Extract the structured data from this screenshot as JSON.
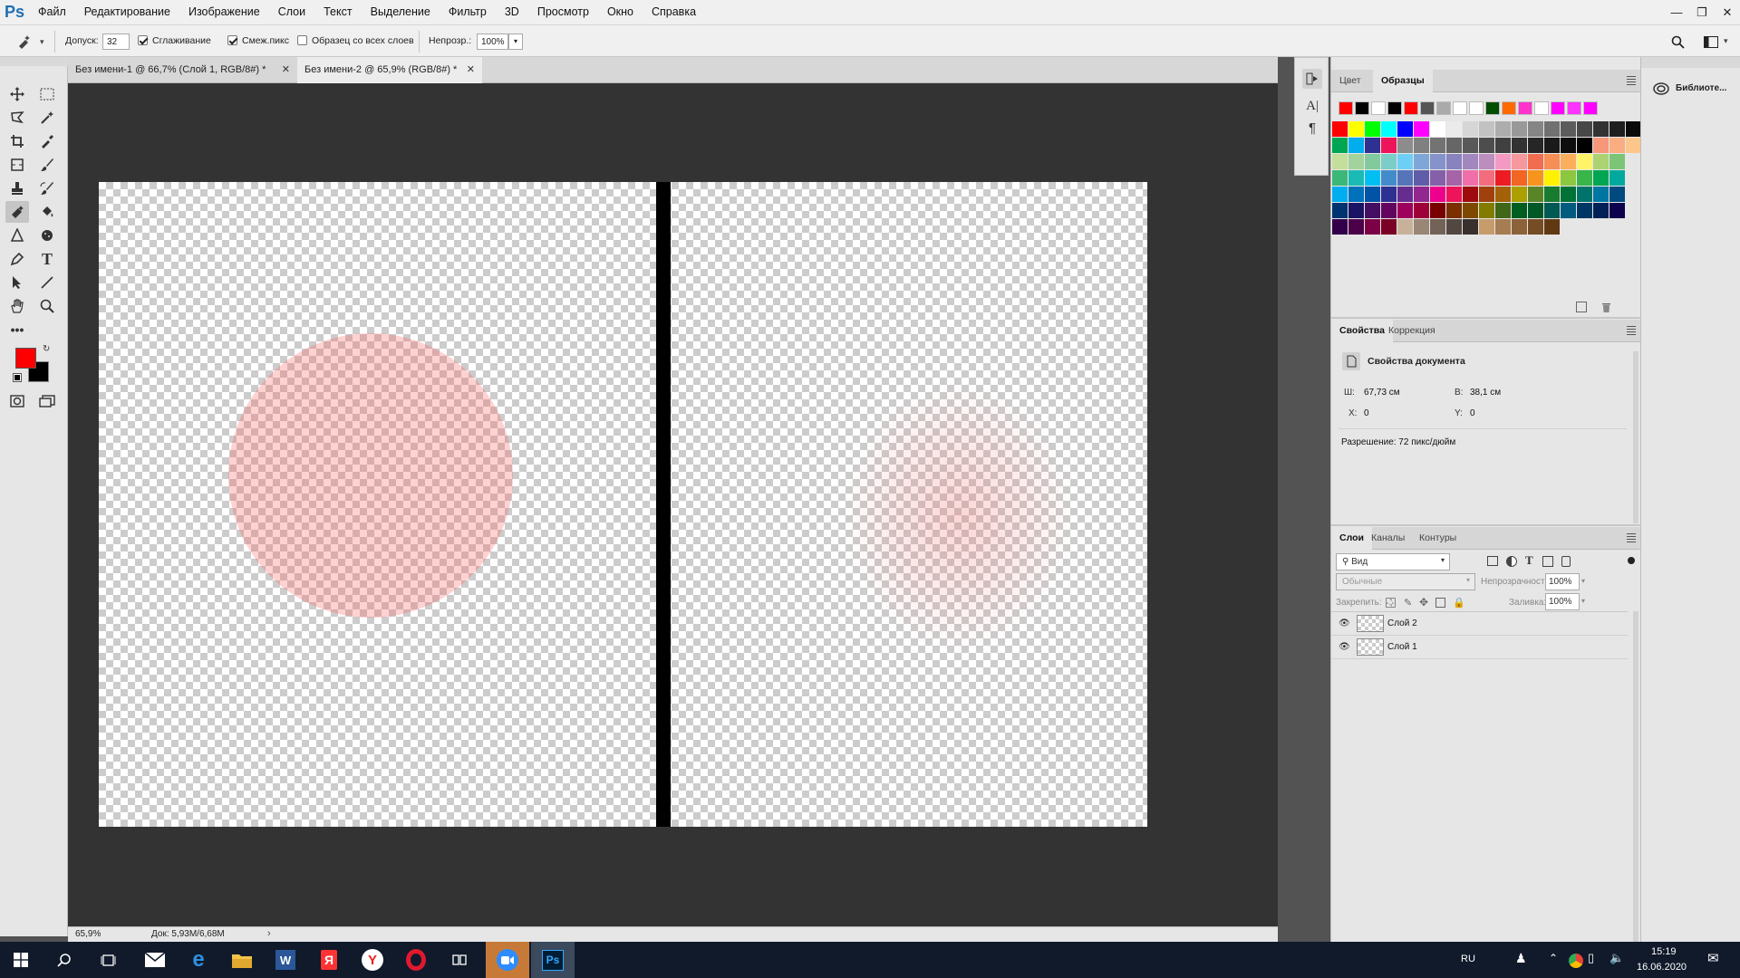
{
  "app": {
    "logo": "Ps"
  },
  "menu": [
    "Файл",
    "Редактирование",
    "Изображение",
    "Слои",
    "Текст",
    "Выделение",
    "Фильтр",
    "3D",
    "Просмотр",
    "Окно",
    "Справка"
  ],
  "options": {
    "tolerance_label": "Допуск:",
    "tolerance_value": "32",
    "antialias_label": "Сглаживание",
    "contiguous_label": "Смеж.пикс",
    "all_layers_label": "Образец со всех слоев",
    "opacity_label": "Непрозр.:",
    "opacity_value": "100%"
  },
  "tabs": [
    {
      "label": "Без имени-1 @ 66,7% (Слой 1, RGB/8#) *"
    },
    {
      "label": "Без имени-2 @ 65,9% (RGB/8#) *"
    }
  ],
  "status": {
    "zoom": "65,9%",
    "doc": "Док: 5,93М/6,68М"
  },
  "swatches_panel": {
    "tabs": [
      "Цвет",
      "Образцы"
    ],
    "recent": [
      "#ff0000",
      "#000000",
      "#ffffff",
      "#000000",
      "#ff0000",
      "#555555",
      "#aaaaaa",
      "#ffffff",
      "#ffffff",
      "#004d00",
      "#ff6a00",
      "#ff33cc",
      "#ffffff",
      "#ff00ff",
      "#ff33ff",
      "#ff00ff"
    ],
    "rows": [
      [
        "#ff0000",
        "#ffff00",
        "#00ff00",
        "#00ffff",
        "#0000ff",
        "#ff00ff",
        "#ffffff",
        "#ebebeb",
        "#d6d6d6",
        "#c2c2c2",
        "#adadad",
        "#999999",
        "#858585",
        "#707070",
        "#5c5c5c",
        "#474747",
        "#333333",
        "#1f1f1f",
        "#0a0a0a",
        "#000000",
        "#ff0000",
        "#ffff00"
      ],
      [
        "#00a651",
        "#00aeef",
        "#2e3192",
        "#ed145b",
        "#8c8c8c",
        "#808080",
        "#737373",
        "#666666",
        "#595959",
        "#4d4d4d",
        "#404040",
        "#333333",
        "#262626",
        "#1a1a1a",
        "#0d0d0d",
        "#000000",
        "#f7977a",
        "#f9ad81",
        "#fdc68a",
        "#fff79a"
      ],
      [
        "#c4df9b",
        "#a3d39c",
        "#82ca9d",
        "#7bcdc8",
        "#6ecff6",
        "#7ea7d8",
        "#8493ca",
        "#8882be",
        "#a187be",
        "#bc8dbf",
        "#f49ac2",
        "#f6989d",
        "#f26c4f",
        "#f68e55",
        "#fbaf5c",
        "#fff467",
        "#acd372",
        "#7cc576"
      ],
      [
        "#3bb878",
        "#1abbb4",
        "#00bff3",
        "#438ccb",
        "#5574b9",
        "#605ca8",
        "#8560a8",
        "#a763a8",
        "#f06eaa",
        "#f26d7d",
        "#ed1c24",
        "#f26522",
        "#f7941d",
        "#fff200",
        "#8dc73f",
        "#39b54a",
        "#00a651",
        "#00a99d"
      ],
      [
        "#00aeef",
        "#0072bc",
        "#0054a6",
        "#2e3192",
        "#662d91",
        "#92278f",
        "#ec008c",
        "#ed145b",
        "#9e0b0f",
        "#a0410d",
        "#a36209",
        "#aba000",
        "#598527",
        "#197b30",
        "#007236",
        "#00746b",
        "#0076a3",
        "#004a80"
      ],
      [
        "#003471",
        "#1b1464",
        "#440e62",
        "#630460",
        "#9e005d",
        "#9e0039",
        "#790000",
        "#7b2e00",
        "#7d4900",
        "#827b00",
        "#406618",
        "#005e20",
        "#005826",
        "#005952",
        "#005b7f",
        "#003663",
        "#002157",
        "#0d004c"
      ],
      [
        "#32004b",
        "#4b0049",
        "#7b0046",
        "#7a0026",
        "#c7b299",
        "#998675",
        "#736357",
        "#534741",
        "#37302d",
        "#c69c6d",
        "#a67c52",
        "#8c6239",
        "#754c24",
        "#603913"
      ]
    ]
  },
  "properties_panel": {
    "tabs": [
      "Свойства",
      "Коррекция"
    ],
    "title": "Свойства документа",
    "w_label": "Ш:",
    "w_value": "67,73 см",
    "h_label": "В:",
    "h_value": "38,1 см",
    "x_label": "X:",
    "x_value": "0",
    "y_label": "Y:",
    "y_value": "0",
    "resolution": "Разрешение: 72 пикс/дюйм"
  },
  "layers_panel": {
    "tabs": [
      "Слои",
      "Каналы",
      "Контуры"
    ],
    "filter_label": "Вид",
    "blend_mode": "Обычные",
    "opacity_label": "Непрозрачность:",
    "opacity_value": "100%",
    "lock_label": "Закрепить:",
    "fill_label": "Заливка:",
    "fill_value": "100%",
    "layers": [
      {
        "name": "Слой 2"
      },
      {
        "name": "Слой 1"
      }
    ]
  },
  "libraries": {
    "label": "Библиоте..."
  },
  "taskbar": {
    "lang": "RU",
    "time": "15:19",
    "date": "16.06.2020"
  }
}
